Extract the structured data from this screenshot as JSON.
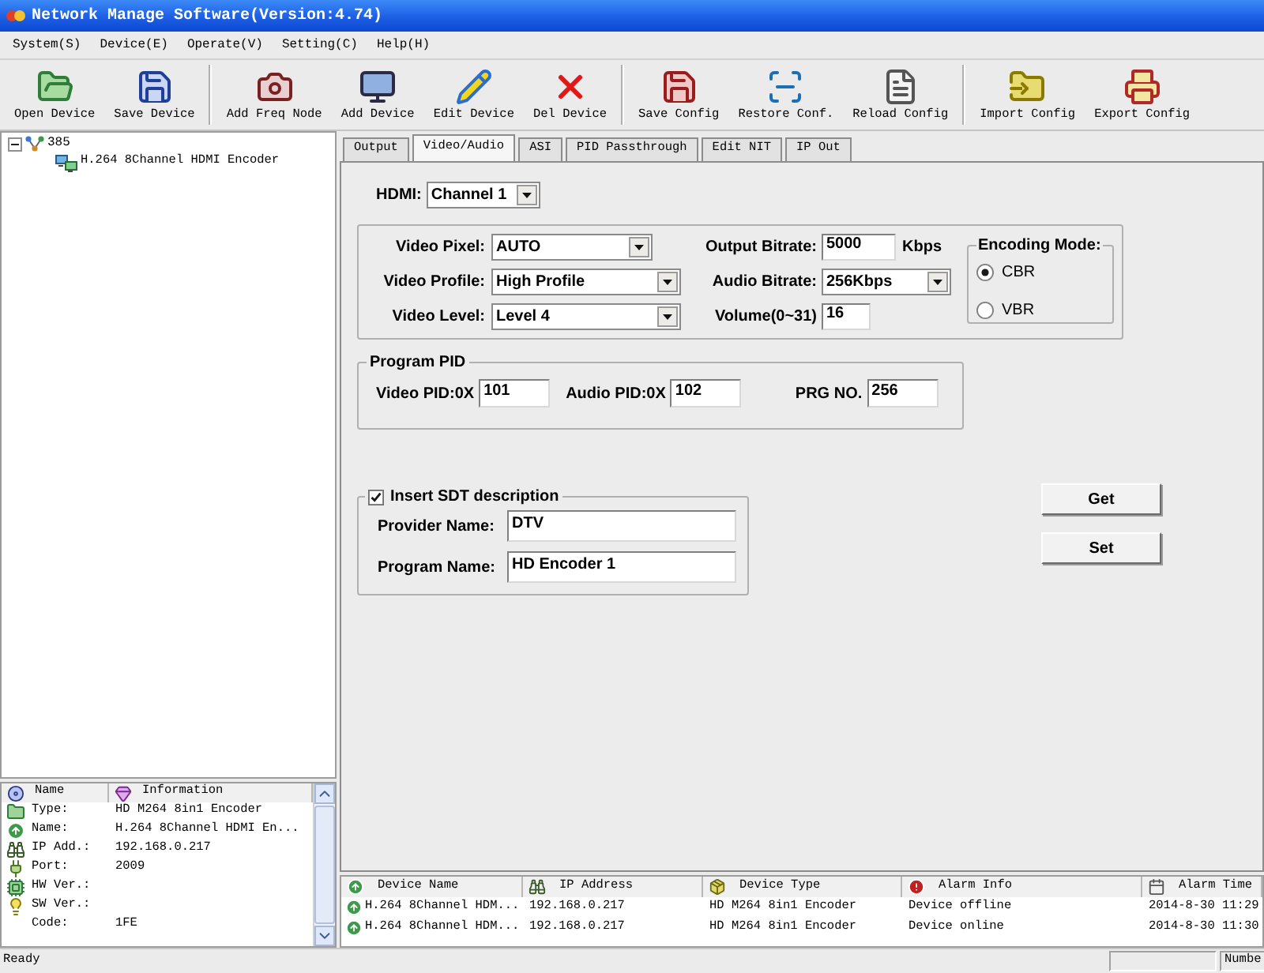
{
  "window": {
    "title": "Network Manage Software(Version:4.74)"
  },
  "menu": [
    "System(S)",
    "Device(E)",
    "Operate(V)",
    "Setting(C)",
    "Help(H)"
  ],
  "toolbar": {
    "groups": [
      [
        {
          "label": "Open Device"
        },
        {
          "label": "Save Device"
        }
      ],
      [
        {
          "label": "Add Freq Node"
        },
        {
          "label": "Add Device"
        },
        {
          "label": "Edit Device"
        },
        {
          "label": "Del Device"
        }
      ],
      [
        {
          "label": "Save Config"
        },
        {
          "label": "Restore Conf."
        },
        {
          "label": "Reload Config"
        }
      ],
      [
        {
          "label": "Import Config"
        },
        {
          "label": "Export Config"
        }
      ]
    ]
  },
  "tree": [
    {
      "label": "385",
      "expanded": true,
      "children": [
        {
          "label": "H.264 8Channel HDMI Encoder"
        }
      ]
    }
  ],
  "tabs": [
    {
      "label": "Output",
      "selected": false
    },
    {
      "label": "Video/Audio",
      "selected": true
    },
    {
      "label": "ASI",
      "selected": false
    },
    {
      "label": "PID Passthrough",
      "selected": false
    },
    {
      "label": "Edit NIT",
      "selected": false
    },
    {
      "label": "IP Out",
      "selected": false
    }
  ],
  "hdmi": {
    "label": "HDMI:",
    "value": "Channel 1"
  },
  "video": {
    "left": [
      {
        "label": "Video Pixel:",
        "kind": "select",
        "value": "AUTO"
      },
      {
        "label": "Video Profile:",
        "kind": "select",
        "value": "High Profile"
      },
      {
        "label": "Video Level:",
        "kind": "select",
        "value": "Level 4"
      }
    ],
    "right": [
      {
        "label": "Output Bitrate:",
        "kind": "input",
        "value": "5000",
        "unit": "Kbps"
      },
      {
        "label": "Audio Bitrate:",
        "kind": "select",
        "value": "256Kbps"
      },
      {
        "label": "Volume(0~31)",
        "kind": "input",
        "value": "16"
      }
    ]
  },
  "encoding_mode": {
    "title": "Encoding Mode:",
    "options": [
      {
        "label": "CBR",
        "selected": true
      },
      {
        "label": "VBR",
        "selected": false
      }
    ]
  },
  "program_pid": {
    "title": "Program PID",
    "fields": [
      {
        "label": "Video PID:0X",
        "value": "101"
      },
      {
        "label": "Audio PID:0X",
        "value": "102"
      },
      {
        "label": "PRG NO.",
        "value": "256"
      }
    ]
  },
  "sdt": {
    "checkbox": {
      "label": "Insert SDT description",
      "checked": true
    },
    "fields": [
      {
        "label": "Provider Name:",
        "value": "DTV"
      },
      {
        "label": "Program Name:",
        "value": "HD Encoder 1"
      }
    ]
  },
  "actions": [
    "Get",
    "Set"
  ],
  "info_panel": {
    "columns": [
      "Name",
      "Information"
    ],
    "rows": [
      {
        "kind": "type",
        "name": "Type:",
        "value": "HD M264 8in1 Encoder"
      },
      {
        "kind": "name",
        "name": "Name:",
        "value": "H.264 8Channel HDMI En..."
      },
      {
        "kind": "ip",
        "name": "IP Add.:",
        "value": "192.168.0.217"
      },
      {
        "kind": "port",
        "name": "Port:",
        "value": "2009"
      },
      {
        "kind": "hw",
        "name": "HW Ver.:"
      },
      {
        "kind": "sw",
        "name": "SW Ver.:"
      },
      {
        "kind": "code",
        "name": "Code:",
        "value": "1FE"
      }
    ]
  },
  "device_list": {
    "columns": [
      "Device Name",
      "IP Address",
      "Device Type",
      "Alarm Info",
      "Alarm Time"
    ],
    "rows": [
      [
        "H.264 8Channel HDM...",
        "192.168.0.217",
        "HD M264 8in1 Encoder",
        "Device offline",
        "2014-8-30 11:29"
      ],
      [
        "H.264 8Channel HDM...",
        "192.168.0.217",
        "HD M264 8in1 Encoder",
        "Device online",
        "2014-8-30 11:30"
      ]
    ]
  },
  "status_bar": {
    "text": "Ready",
    "panel": "Numbe"
  }
}
